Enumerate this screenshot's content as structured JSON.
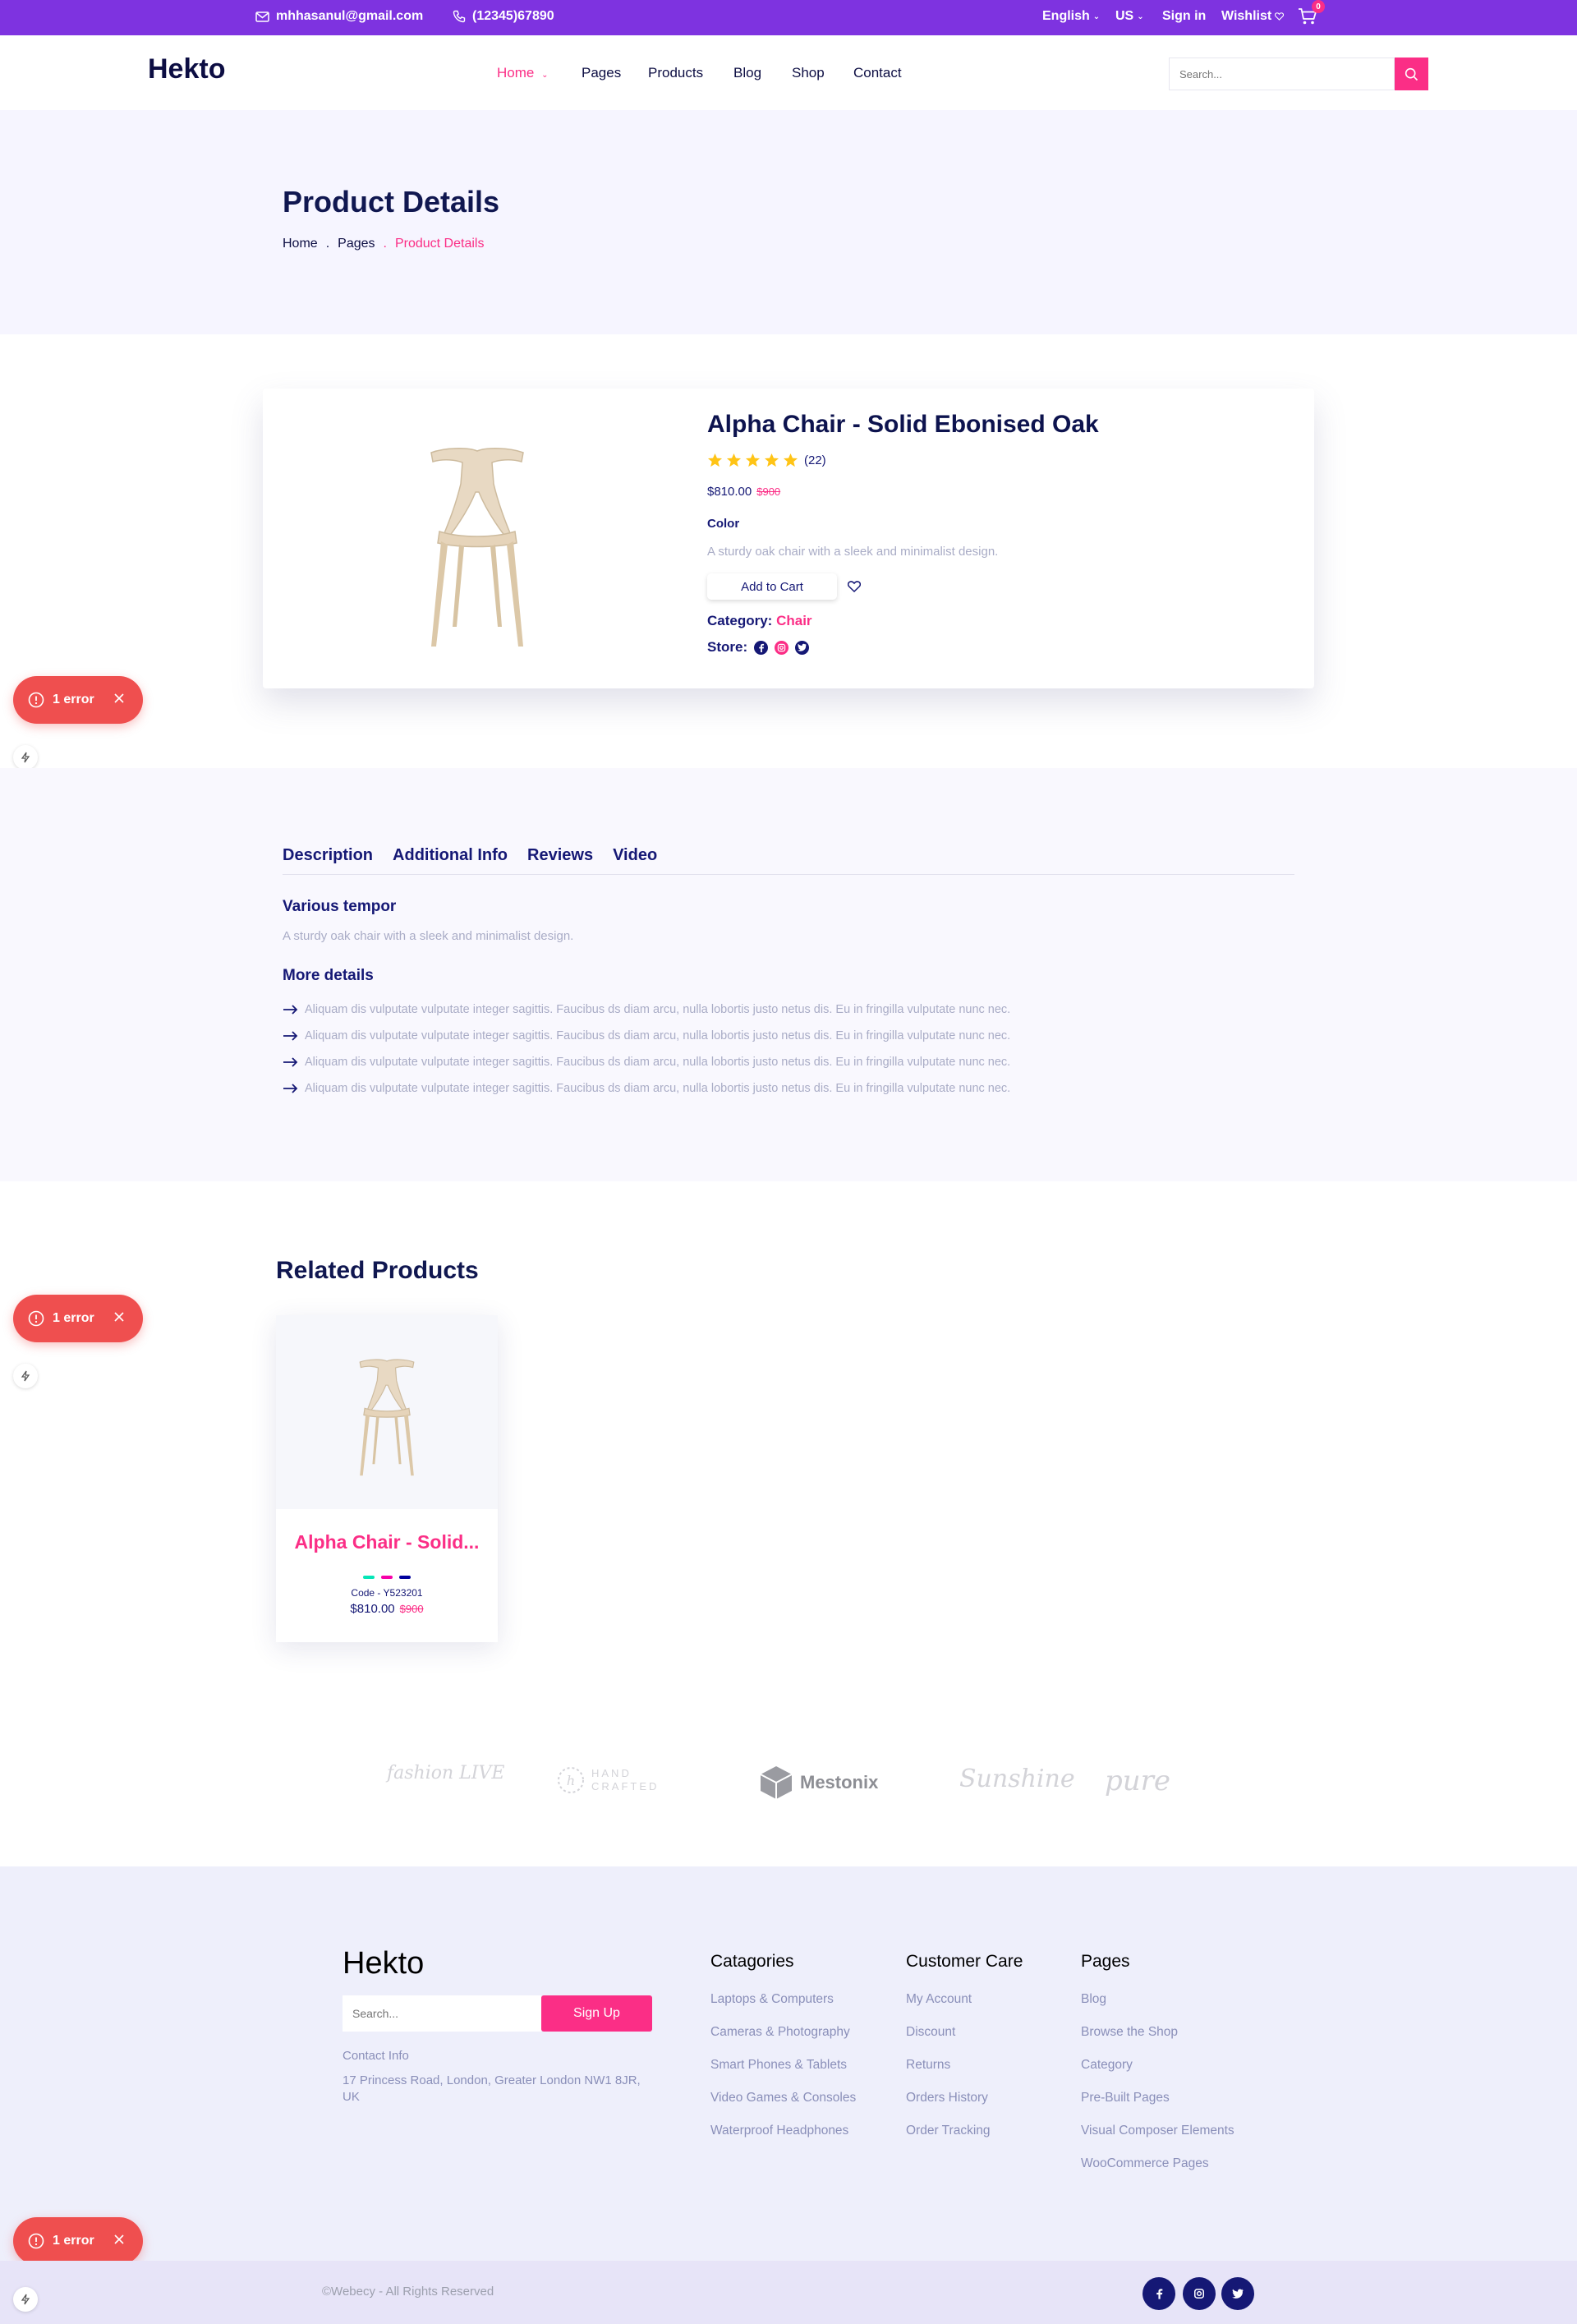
{
  "topbar": {
    "email": "mhhasanul@gmail.com",
    "phone": "(12345)67890",
    "language": "English",
    "currency": "US",
    "sign_in": "Sign in",
    "wishlist": "Wishlist",
    "cart_count": "0",
    "icons": {
      "email": "envelope-icon",
      "phone": "phone-icon",
      "cart": "cart-icon"
    }
  },
  "nav": {
    "logo": "Hekto",
    "links": [
      "Home",
      "Pages",
      "Products",
      "Blog",
      "Shop",
      "Contact"
    ],
    "active": "Home",
    "search_placeholder": "Search..."
  },
  "banner": {
    "title": "Product Details",
    "crumbs": [
      "Home",
      "Pages",
      "Product Details"
    ]
  },
  "product": {
    "title": "Alpha Chair - Solid Ebonised Oak",
    "rating": 5,
    "reviews": "(22)",
    "price": "$810.00",
    "old_price": "$900",
    "color_label": "Color",
    "description": "A sturdy oak chair with a sleek and minimalist design.",
    "add_to_cart": "Add to Cart",
    "category_label": "Category:",
    "category": "Chair",
    "store_label": "Store:"
  },
  "errors": {
    "label": "1 error"
  },
  "details": {
    "tabs": [
      "Description",
      "Additional Info",
      "Reviews",
      "Video"
    ],
    "heading1": "Various tempor",
    "text1": "A sturdy oak chair with a sleek and minimalist design.",
    "heading2": "More details",
    "bullets": [
      "Aliquam dis vulputate vulputate integer sagittis. Faucibus ds diam arcu, nulla lobortis justo netus dis. Eu in fringilla vulputate nunc nec.",
      "Aliquam dis vulputate vulputate integer sagittis. Faucibus ds diam arcu, nulla lobortis justo netus dis. Eu in fringilla vulputate nunc nec.",
      "Aliquam dis vulputate vulputate integer sagittis. Faucibus ds diam arcu, nulla lobortis justo netus dis. Eu in fringilla vulputate nunc nec.",
      "Aliquam dis vulputate vulputate integer sagittis. Faucibus ds diam arcu, nulla lobortis justo netus dis. Eu in fringilla vulputate nunc nec."
    ]
  },
  "related": {
    "title": "Related Products",
    "card": {
      "name": "Alpha Chair - Solid...",
      "code": "Code - Y523201",
      "price": "$810.00",
      "old_price": "$900",
      "swatches": [
        "#05E6B7",
        "#F701A8",
        "#00009D"
      ]
    }
  },
  "brands": [
    "fashion LIVE",
    "HAND CRAFTED",
    "Mestonix",
    "Sunshine",
    "pure"
  ],
  "footer": {
    "logo": "Hekto",
    "search_placeholder": "Search...",
    "signup": "Sign Up",
    "contact_label": "Contact Info",
    "address": "17 Princess Road, London, Greater London NW1 8JR, UK",
    "columns": [
      {
        "title": "Catagories",
        "links": [
          "Laptops & Computers",
          "Cameras & Photography",
          "Smart Phones & Tablets",
          "Video Games & Consoles",
          "Waterproof Headphones"
        ]
      },
      {
        "title": "Customer Care",
        "links": [
          "My Account",
          "Discount",
          "Returns",
          "Orders History",
          "Order Tracking"
        ]
      },
      {
        "title": "Pages",
        "links": [
          "Blog",
          "Browse the Shop",
          "Category",
          "Pre-Built Pages",
          "Visual Composer Elements",
          "WooCommerce Pages"
        ]
      }
    ],
    "copyright": "©Webecy - All Rights Reserved"
  },
  "colors": {
    "purple": "#7E33E0",
    "pink": "#FB2E86",
    "navy": "#151875",
    "error": "#EF4F4F"
  }
}
